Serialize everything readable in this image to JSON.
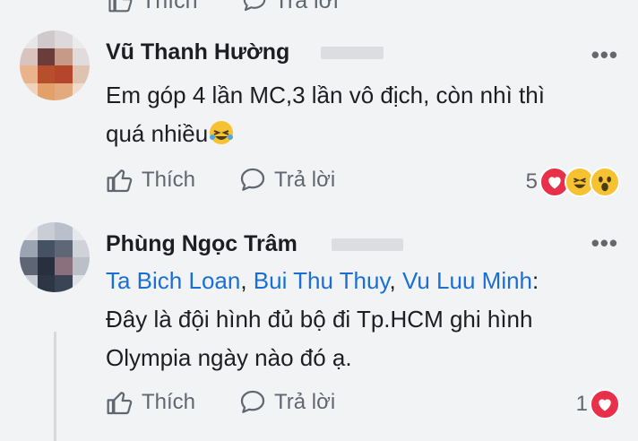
{
  "top_actions": {
    "like_label": "Thích",
    "reply_label": "Trả lời"
  },
  "comments": [
    {
      "author": "Vũ Thanh Hường",
      "line1": "Em góp 4 lần MC,3 lần vô địch, còn nhì thì",
      "line2": "quá nhiều",
      "like_label": "Thích",
      "reply_label": "Trả lời",
      "reaction_count": "5",
      "reactions": [
        "love",
        "haha",
        "wow"
      ]
    },
    {
      "author": "Phùng Ngọc Trâm",
      "mentions": [
        "Ta Bich Loan",
        "Bui Thu Thuy",
        "Vu Luu Minh"
      ],
      "sep": ", ",
      "colon": ":",
      "line2": "Đây là đội hình đủ bộ đi Tp.HCM ghi hình",
      "line3": "Olympia ngày nào đó ạ.",
      "like_label": "Thích",
      "reply_label": "Trả lời",
      "reaction_count": "1",
      "reactions": [
        "love"
      ]
    }
  ],
  "colors": {
    "mention": "#1a6fd6",
    "love": "#e8304a",
    "haha": "#f7c232",
    "muted": "#606770"
  },
  "icons": {
    "like": "thumbs-up-icon",
    "reply": "speech-bubble-icon",
    "more": "more-options-icon"
  }
}
